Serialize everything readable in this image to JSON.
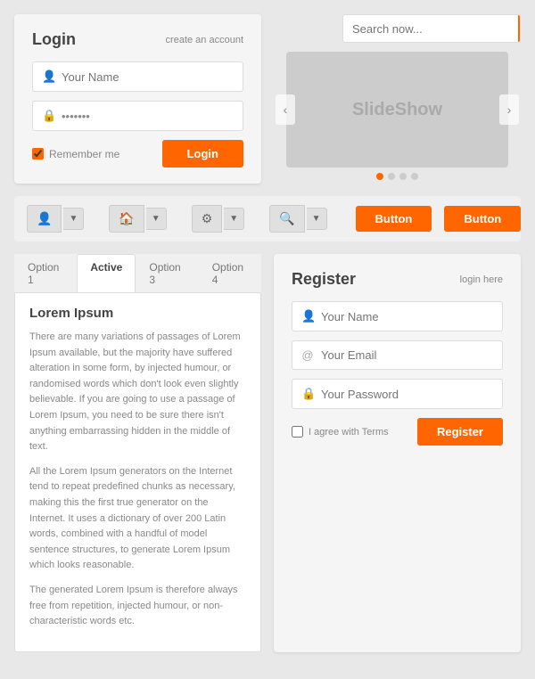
{
  "login": {
    "title": "Login",
    "create_account": "create an account",
    "name_placeholder": "Your Name",
    "password_value": "•••••••",
    "remember_label": "Remember me",
    "login_btn": "Login"
  },
  "search": {
    "placeholder": "Search now...",
    "btn_icon": "🔍"
  },
  "slideshow": {
    "label": "SlideShow",
    "nav_left": "‹",
    "nav_right": "›",
    "dots": [
      true,
      false,
      false,
      false
    ]
  },
  "toolbar": {
    "icons": [
      "👤",
      "🏠",
      "⚙",
      "🔍"
    ],
    "buttons": [
      "Button",
      "Button"
    ]
  },
  "tabs": {
    "items": [
      "Option 1",
      "Active",
      "Option 3",
      "Option 4"
    ],
    "active_index": 1
  },
  "content": {
    "title": "Lorem Ipsum",
    "para1": "There are many variations of passages of Lorem Ipsum available, but the majority have suffered alteration in some form, by injected humour, or randomised words which don't look even slightly believable. If you are going to use a passage of Lorem Ipsum, you need to be sure there isn't anything embarrassing hidden in the middle of text.",
    "para2": "All the Lorem Ipsum generators on the Internet tend to repeat predefined chunks as necessary, making this the first true generator on the Internet. It uses a dictionary of over 200 Latin words, combined with a handful of model sentence structures, to generate Lorem Ipsum which looks reasonable.",
    "para3": "The generated Lorem Ipsum is therefore always free from repetition, injected humour, or non-characteristic words etc."
  },
  "register": {
    "title": "Register",
    "login_here": "login here",
    "name_placeholder": "Your Name",
    "email_placeholder": "Your Email",
    "password_placeholder": "Your Password",
    "agree_label": "I agree with Terms",
    "register_btn": "Register"
  }
}
